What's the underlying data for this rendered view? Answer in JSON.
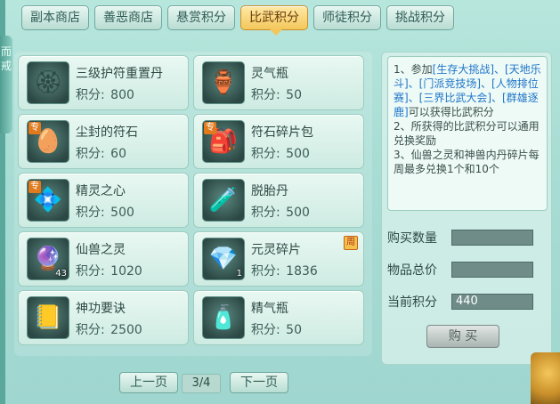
{
  "left_deco": {
    "text": "而\n戒"
  },
  "tabs": [
    {
      "label": "副本商店",
      "active": false
    },
    {
      "label": "善恶商店",
      "active": false
    },
    {
      "label": "悬赏积分",
      "active": false
    },
    {
      "label": "比武积分",
      "active": true
    },
    {
      "label": "师徒积分",
      "active": false
    },
    {
      "label": "挑战积分",
      "active": false
    }
  ],
  "price_prefix": "积分:",
  "items": [
    {
      "name": "三级护符重置丹",
      "price": "800",
      "icon": "gold-amulet-icon",
      "glyph": "🏵",
      "special": false,
      "count": ""
    },
    {
      "name": "灵气瓶",
      "price": "50",
      "icon": "spirit-vase-icon",
      "glyph": "🏺",
      "special": false,
      "count": ""
    },
    {
      "name": "尘封的符石",
      "price": "60",
      "icon": "sealed-rune-stone-icon",
      "glyph": "🥚",
      "special": true,
      "count": ""
    },
    {
      "name": "符石碎片包",
      "price": "500",
      "icon": "rune-fragment-bag-icon",
      "glyph": "🎒",
      "special": true,
      "count": ""
    },
    {
      "name": "精灵之心",
      "price": "500",
      "icon": "spirit-heart-icon",
      "glyph": "💠",
      "special": true,
      "count": ""
    },
    {
      "name": "脱胎丹",
      "price": "500",
      "icon": "rebirth-pill-icon",
      "glyph": "🧪",
      "special": false,
      "count": ""
    },
    {
      "name": "仙兽之灵",
      "price": "1020",
      "icon": "beast-spirit-orb-icon",
      "glyph": "🔮",
      "special": false,
      "count": "43"
    },
    {
      "name": "元灵碎片",
      "price": "1836",
      "icon": "yuanling-fragment-icon",
      "glyph": "💎",
      "special": false,
      "count": "1",
      "week_tag": "周"
    },
    {
      "name": "神功要诀",
      "price": "2500",
      "icon": "skill-manual-icon",
      "glyph": "📒",
      "special": false,
      "count": ""
    },
    {
      "name": "精气瓶",
      "price": "50",
      "icon": "essence-bottle-icon",
      "glyph": "🧴",
      "special": false,
      "count": ""
    }
  ],
  "special_badge": "专",
  "rules": {
    "line1_prefix": "1、参加",
    "line1_links": "[生存大挑战]、[天地乐斗]、[门派竞技场]、[人物排位赛]、[三界比武大会]、[群雄逐鹿]",
    "line1_suffix": "可以获得比武积分",
    "line2": "2、所获得的比武积分可以通用兑换奖励",
    "line3": "3、仙兽之灵和神兽内丹碎片每周最多兑换1个和10个"
  },
  "fields": {
    "quantity_label": "购买数量",
    "quantity_value": "",
    "total_label": "物品总价",
    "total_value": "",
    "points_label": "当前积分",
    "points_value": "440"
  },
  "buy_label": "购 买",
  "pager": {
    "prev_label": "上一页",
    "page_text": "3/4",
    "next_label": "下一页"
  },
  "colors": {
    "accent_active_tab": "#f3c75b",
    "rule_link": "#1f75c9",
    "panel_bg": "#9fd6cf"
  }
}
